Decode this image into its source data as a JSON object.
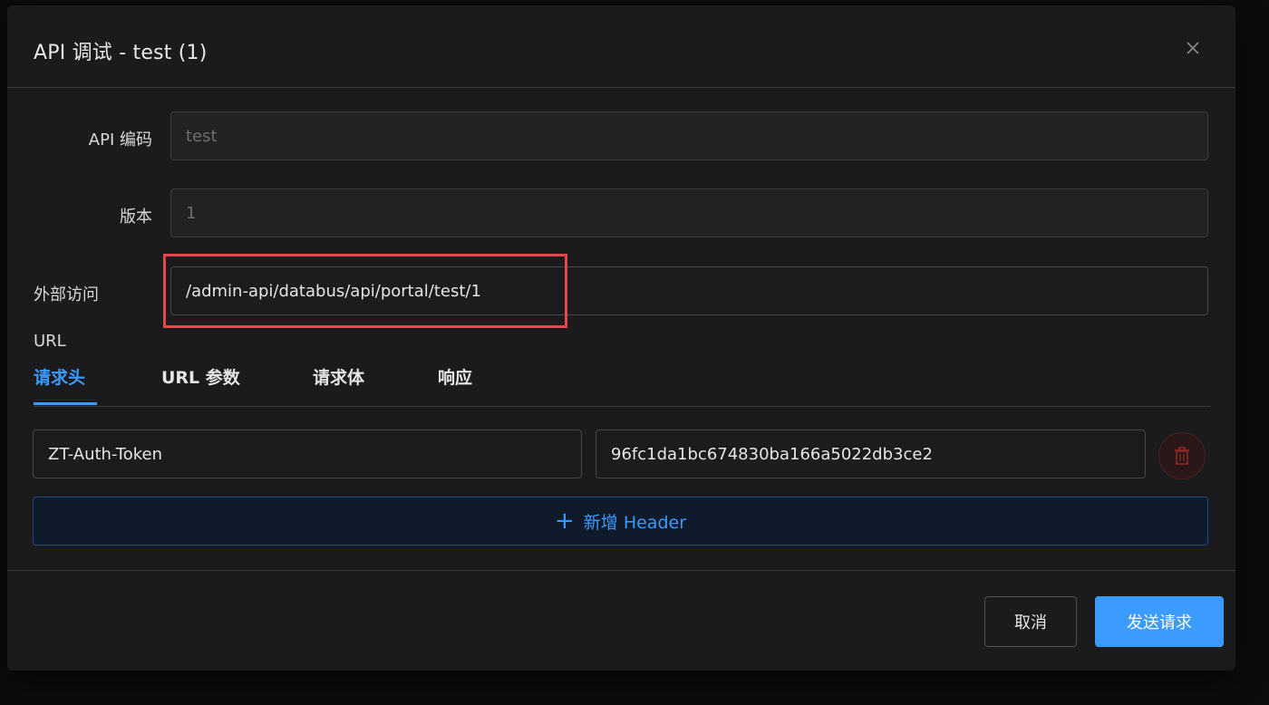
{
  "dialog": {
    "title": "API 调试 - test (1)"
  },
  "form": {
    "api_code_label": "API 编码",
    "api_code_value": "test",
    "version_label": "版本",
    "version_value": "1",
    "external_url_label_line1": "外部访问",
    "external_url_label_line2": "URL",
    "external_url_value": "/admin-api/databus/api/portal/test/1"
  },
  "tabs": [
    {
      "label": "请求头",
      "active": true
    },
    {
      "label": "URL 参数",
      "active": false
    },
    {
      "label": "请求体",
      "active": false
    },
    {
      "label": "响应",
      "active": false
    }
  ],
  "headers": [
    {
      "key": "ZT-Auth-Token",
      "value": "96fc1da1bc674830ba166a5022db3ce2"
    }
  ],
  "add_header_label": "新增 Header",
  "footer": {
    "cancel_label": "取消",
    "send_label": "发送请求"
  },
  "colors": {
    "accent": "#3b9bff",
    "highlight": "#e5484d",
    "danger": "#c0392b"
  },
  "icons": {
    "close": "close-icon",
    "delete": "trash-icon",
    "add": "plus-icon"
  }
}
